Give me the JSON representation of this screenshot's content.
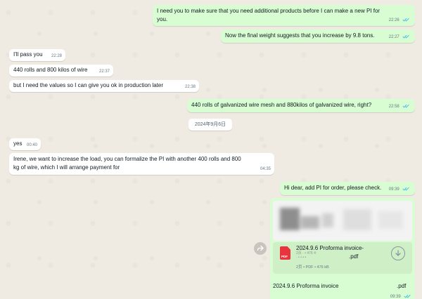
{
  "messages": [
    {
      "id": "m1",
      "text_line1": "I need you to make sure that you need additional products before I can make a new PI for",
      "text_line2": "you.",
      "time": "22:26"
    },
    {
      "id": "m2",
      "text": "Now the final weight suggests that you increase by 9.8 tons.",
      "time": "22:27"
    },
    {
      "id": "m3",
      "text": "I'll pass you",
      "time": "22:28"
    },
    {
      "id": "m4",
      "text": "440 rolls and 800 kilos of wire",
      "time": "22:37"
    },
    {
      "id": "m5",
      "text": "but I need the values so I can give you ok in production later",
      "time": "22:38"
    },
    {
      "id": "m6",
      "text": "440 rolls of galvanized wire mesh and 880kilos of galvanized wire, right?",
      "time": "22:58"
    },
    {
      "id": "m7",
      "text": "yes",
      "time": "00:40"
    },
    {
      "id": "m8",
      "text_line1": "Irene, we want to increase the load, you can formalize the PI with another 400 rolls and 800",
      "text_line2": "kg of wire, which I will arrange payment for",
      "time": "04:35"
    },
    {
      "id": "m9",
      "text": "Hi dear, add PI for order, please check.",
      "time": "09:39"
    }
  ],
  "date_separator": "2024年9月6日",
  "document": {
    "file_name_line1": "2024.9.6 Proforma invoice-",
    "file_name_line2": ".pdf",
    "meta_blur_1": "2页 · • 476 4:",
    "meta_blur_2": "· • • • •",
    "meta_line": "2页 • PDF • 476 kB",
    "pdf_label": "PDF",
    "caption_left": "2024.9.6 Proforma invoice",
    "caption_right": ".pdf",
    "time": "09:39"
  },
  "colors": {
    "outgoing_bubble": "#d9fdd3",
    "incoming_bubble": "#ffffff",
    "read_ticks": "#53bdeb",
    "pdf_icon": "#e9343e"
  }
}
